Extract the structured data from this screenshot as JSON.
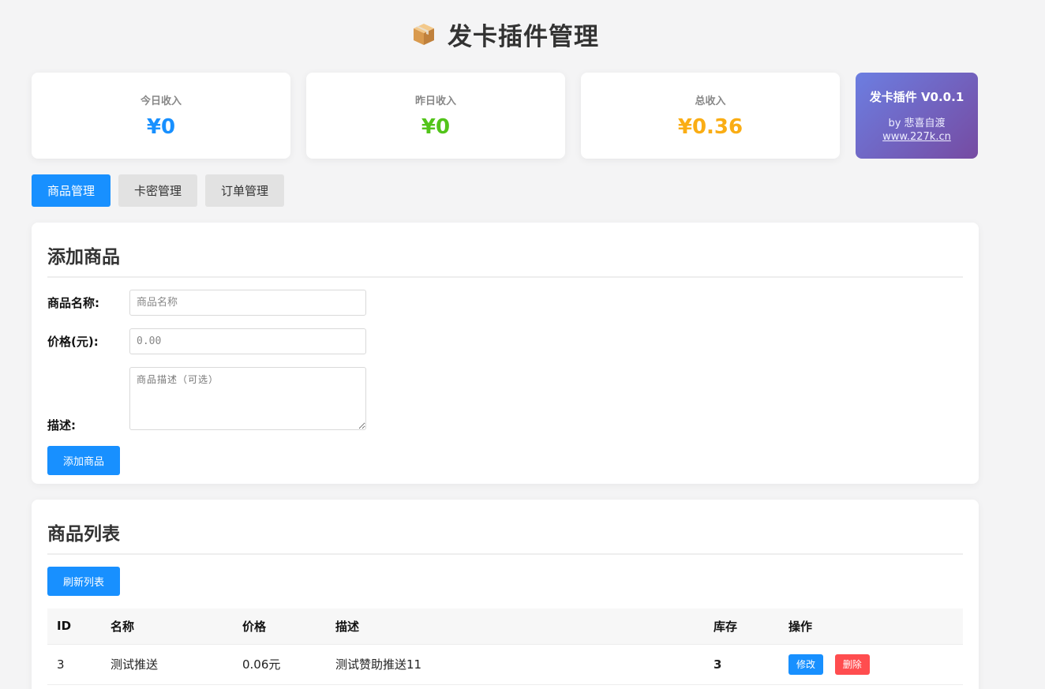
{
  "header": {
    "title": "发卡插件管理",
    "icon": "package-icon"
  },
  "stats": [
    {
      "label": "今日收入",
      "value": "¥0",
      "color": "#1890ff"
    },
    {
      "label": "昨日收入",
      "value": "¥0",
      "color": "#52c41a"
    },
    {
      "label": "总收入",
      "value": "¥0.36",
      "color": "#faad14"
    }
  ],
  "brand": {
    "title": "发卡插件 V0.0.1",
    "author": "by 悲喜自渡",
    "link": "www.227k.cn"
  },
  "tabs": [
    {
      "label": "商品管理",
      "active": true
    },
    {
      "label": "卡密管理",
      "active": false
    },
    {
      "label": "订单管理",
      "active": false
    }
  ],
  "add_form": {
    "title": "添加商品",
    "name_label": "商品名称:",
    "name_placeholder": "商品名称",
    "price_label": "价格(元):",
    "price_placeholder": "0.00",
    "desc_label": "描述:",
    "desc_placeholder": "商品描述（可选）",
    "submit_label": "添加商品"
  },
  "list": {
    "title": "商品列表",
    "refresh_label": "刷新列表",
    "columns": [
      "ID",
      "名称",
      "价格",
      "描述",
      "库存",
      "操作"
    ],
    "rows": [
      {
        "id": "3",
        "name": "测试推送",
        "price": "0.06元",
        "desc": "测试赞助推送11",
        "stock": "3",
        "edit_label": "修改",
        "delete_label": "删除"
      }
    ]
  }
}
